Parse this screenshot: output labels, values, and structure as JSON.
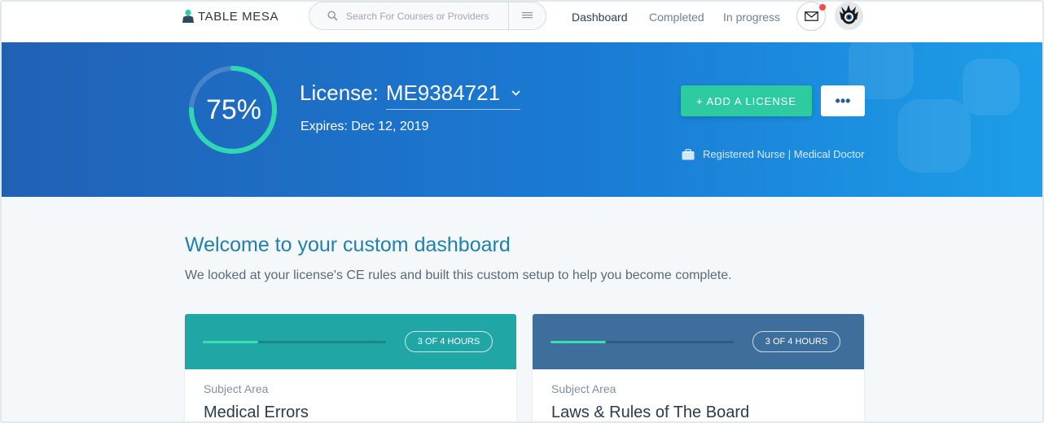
{
  "header": {
    "logo_text": "TABLE MESA",
    "search_placeholder": "Search For Courses or Providers",
    "nav": [
      {
        "label": "Dashboard",
        "active": true
      },
      {
        "label": "Completed",
        "active": false
      },
      {
        "label": "In progress",
        "active": false
      }
    ],
    "notification": true
  },
  "banner": {
    "progress_percent": 75,
    "progress_label": "75%",
    "license_label": "License:",
    "license_number": "ME9384721",
    "expires": "Expires: Dec 12, 2019",
    "add_license_label": "+ ADD A LICENSE",
    "more_label": "•••",
    "roles": "Registered Nurse | Medical Doctor"
  },
  "welcome": {
    "title": "Welcome to your custom dashboard",
    "subtitle": "We looked at your license's CE rules and built this custom setup to help you become complete."
  },
  "cards": [
    {
      "hours": "3 OF 4 HOURS",
      "progress": 0.3,
      "subject_label": "Subject Area",
      "subject": "Medical Errors",
      "color": "#21a6a6"
    },
    {
      "hours": "3 OF 4 HOURS",
      "progress": 0.3,
      "subject_label": "Subject Area",
      "subject": "Laws & Rules of The Board",
      "color": "#3d6e9c"
    }
  ],
  "colors": {
    "accent": "#2ecba0",
    "banner": "#1a7ad3",
    "title": "#1f7fb0"
  },
  "icons": [
    "logo-icon",
    "search-icon",
    "menu-icon",
    "mail-icon",
    "avatar-icon",
    "chevron-down-icon",
    "briefcase-icon"
  ]
}
